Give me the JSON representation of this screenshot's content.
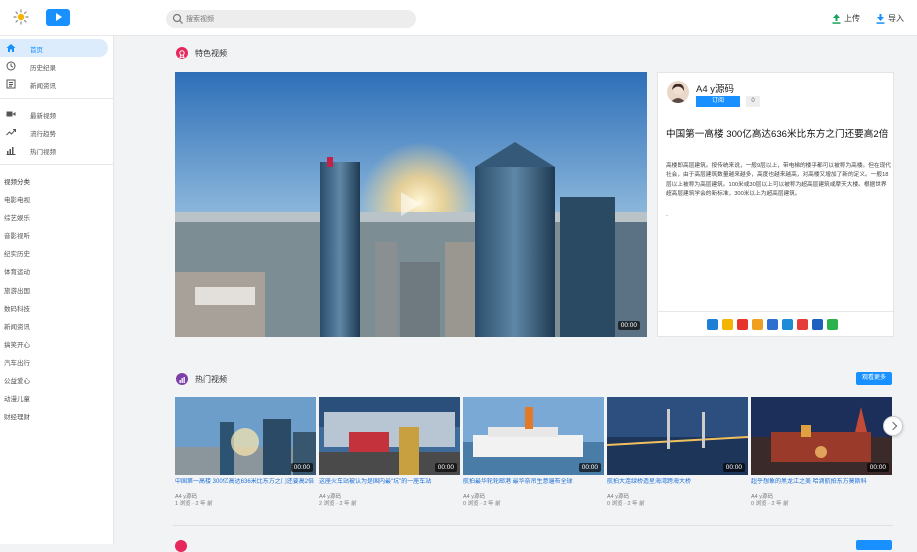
{
  "topbar": {
    "search_placeholder": "搜索视频",
    "upload_label": "上传",
    "import_label": "导入"
  },
  "sidebar": {
    "nav": [
      {
        "label": "首页",
        "icon": "home-icon",
        "active": true
      },
      {
        "label": "历史纪录",
        "icon": "history-icon"
      },
      {
        "label": "新闻资讯",
        "icon": "news-icon"
      }
    ],
    "nav2": [
      {
        "label": "最新视频",
        "icon": "video-camera-icon"
      },
      {
        "label": "流行趋势",
        "icon": "trending-icon"
      },
      {
        "label": "热门视频",
        "icon": "bar-chart-icon"
      }
    ],
    "categories_title": "视频分类",
    "categories": [
      "电影电视",
      "综艺娱乐",
      "音影视听",
      "纪实历史",
      "体育运动",
      "旅游出国",
      "数码科技",
      "新闻资讯",
      "搞笑开心",
      "汽车出行",
      "公益爱心",
      "动漫儿童",
      "财经理财"
    ]
  },
  "featured": {
    "section_title": "特色视频",
    "duration": "00:00",
    "author": "A4 y源码",
    "subscribe_label": "订阅",
    "subscribe_count": "0",
    "title": "中国第一高楼 300亿高达636米比东方之门还要高2倍",
    "description": "高楼即高层建筑。按传统来说，一般9层以上，带电梯的楼乎都可以被称为高楼。但在现代社会，由于高层建筑数量越来越多，高度也越来越高，对高楼又增加了新的定义。一般18层以上被称为高层建筑。100米或30层以上可以被称为超高层建筑或摩天大楼。根据世界超高层建筑学会的新标准，300米以上为超高层建筑。",
    "extra": "-"
  },
  "hot": {
    "section_title": "热门视频",
    "more_label": "观看更多",
    "videos": [
      {
        "title": "中国第一高楼 300亿高达636米比东方之门还要高2倍",
        "author": "A4 y源码",
        "meta": "1 浏览 · 2 年 前",
        "duration": "00:00"
      },
      {
        "title": "这座火车站被认为是国内最\"坑\"的一座车站",
        "author": "A4 y源码",
        "meta": "2 浏览 · 2 年 前",
        "duration": "00:00"
      },
      {
        "title": "航拍最华轮轮邮港 最华奈吊生意遍布全球",
        "author": "A4 y源码",
        "meta": "0 浏览 · 2 年 前",
        "duration": "00:00"
      },
      {
        "title": "航拍大连绿桥造星海湾跨海大桥",
        "author": "A4 y源码",
        "meta": "0 浏览 · 2 年 前",
        "duration": "00:00"
      },
      {
        "title": "超乎想象的黑龙江之美 哈滴航拍东方莫斯科",
        "author": "A4 y源码",
        "meta": "0 浏览 · 2 年 前",
        "duration": "00:00"
      }
    ]
  },
  "colors": {
    "accent": "#1890ff",
    "featured_icon": "#e6285d",
    "hot_icon": "#7b3fa8",
    "link": "#1a6fd8"
  }
}
